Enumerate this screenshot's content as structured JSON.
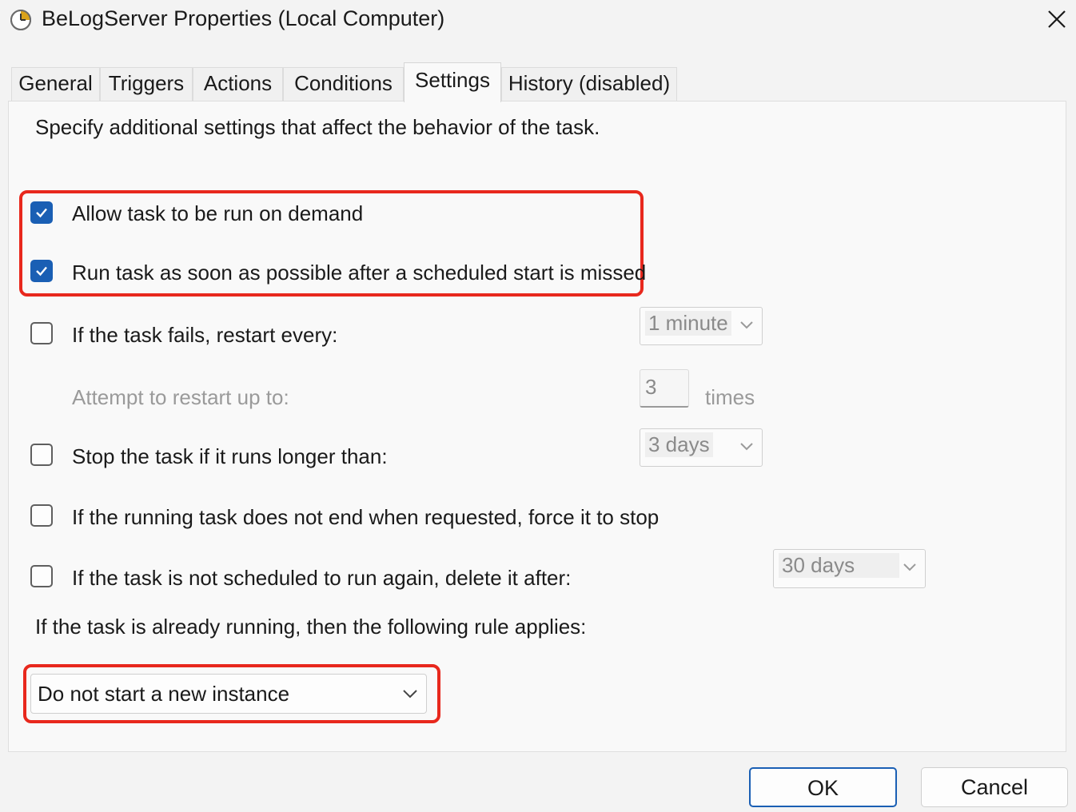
{
  "window": {
    "title": "BeLogServer Properties (Local Computer)",
    "icon": "clock-icon"
  },
  "tabs": [
    {
      "label": "General"
    },
    {
      "label": "Triggers"
    },
    {
      "label": "Actions"
    },
    {
      "label": "Conditions"
    },
    {
      "label": "Settings",
      "active": true
    },
    {
      "label": "History (disabled)"
    }
  ],
  "settings": {
    "description": "Specify additional settings that affect the behavior of the task.",
    "allow_on_demand": {
      "label": "Allow task to be run on demand",
      "checked": true
    },
    "run_asap_missed": {
      "label": "Run task as soon as possible after a scheduled start is missed",
      "checked": true
    },
    "restart_on_fail": {
      "label": "If the task fails, restart every:",
      "checked": false,
      "interval": "1 minute"
    },
    "restart_attempts": {
      "label": "Attempt to restart up to:",
      "value": "3",
      "unit": "times"
    },
    "stop_if_longer": {
      "label": "Stop the task if it runs longer than:",
      "checked": false,
      "duration": "3 days"
    },
    "force_stop": {
      "label": "If the running task does not end when requested, force it to stop",
      "checked": false
    },
    "delete_after": {
      "label": "If the task is not scheduled to run again, delete it after:",
      "checked": false,
      "duration": "30 days"
    },
    "running_rule_label": "If the task is already running, then the following rule applies:",
    "running_rule_value": "Do not start a new instance"
  },
  "buttons": {
    "ok": "OK",
    "cancel": "Cancel"
  },
  "colors": {
    "checkbox_checked": "#1a5fb4",
    "highlight": "#e8281d",
    "ok_border": "#1a5fb4"
  }
}
